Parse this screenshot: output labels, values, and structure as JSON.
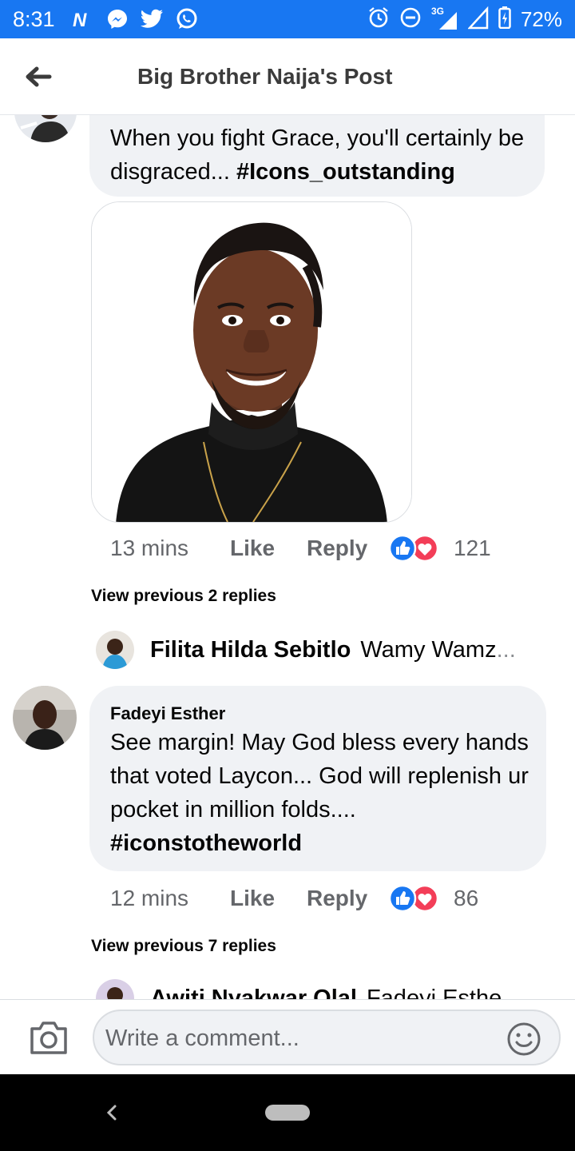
{
  "status_bar": {
    "time": "8:31",
    "left_icons": [
      "n-app-icon",
      "messenger-icon",
      "twitter-icon",
      "whatsapp-icon"
    ],
    "right_icons": [
      "alarm-icon",
      "dnd-icon",
      "signal-3g-icon",
      "signal-icon",
      "battery-charging-icon"
    ],
    "network_label": "3G",
    "battery": "72%"
  },
  "header": {
    "title": "Big Brother Naija's Post"
  },
  "comments": [
    {
      "text": "When you fight Grace, you'll certainly be disgraced...",
      "hashtag": "#Icons_outstanding",
      "time": "13 mins",
      "like_label": "Like",
      "reply_label": "Reply",
      "reactions": [
        "like",
        "love"
      ],
      "reaction_count": "121",
      "view_previous": "View previous 2 replies",
      "reply_preview": {
        "name": "Filita Hilda Sebitlo",
        "text": "Wamy Wamz",
        "ellipsis": "..."
      }
    },
    {
      "author": "Fadeyi Esther",
      "text": "See margin! May God bless every hands that voted Laycon... God will replenish ur pocket in million folds....",
      "hashtag": "#iconstotheworld",
      "time": "12 mins",
      "like_label": "Like",
      "reply_label": "Reply",
      "reactions": [
        "like",
        "love"
      ],
      "reaction_count": "86",
      "view_previous": "View previous 7 replies",
      "reply_preview": {
        "name": "Awiti Nyakwar Olal",
        "text": "Fadeyi Esthe"
      }
    }
  ],
  "composer": {
    "placeholder": "Write a comment..."
  },
  "colors": {
    "brand_blue": "#1877f2",
    "bubble_bg": "#f0f2f5",
    "meta_gray": "#65676b",
    "love_red": "#f33e58"
  }
}
